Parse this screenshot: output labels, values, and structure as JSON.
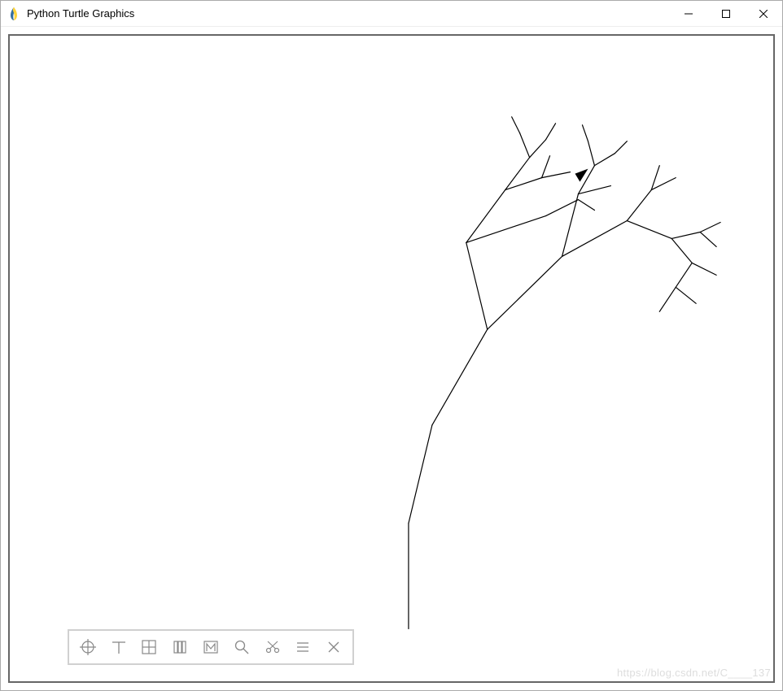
{
  "window": {
    "title": "Python Turtle Graphics",
    "icon_name": "python-feather-icon"
  },
  "controls": {
    "minimize": "Minimize",
    "maximize": "Maximize",
    "close": "Close"
  },
  "toolbar": {
    "items": [
      {
        "name": "target-icon",
        "label": "Target"
      },
      {
        "name": "tee-icon",
        "label": "Tee"
      },
      {
        "name": "grid-icon",
        "label": "Grid"
      },
      {
        "name": "columns-icon",
        "label": "Columns"
      },
      {
        "name": "m-box-icon",
        "label": "M"
      },
      {
        "name": "magnify-icon",
        "label": "Magnify"
      },
      {
        "name": "scissors-icon",
        "label": "Cut"
      },
      {
        "name": "lines-icon",
        "label": "Lines"
      },
      {
        "name": "close-x-icon",
        "label": "Close"
      }
    ]
  },
  "watermark": "https://blog.csdn.net/C____137",
  "drawing": {
    "description": "Recursive fractal tree drawn by turtle, leaning right, with an arrowhead cursor near the top branches.",
    "trunk_start": "bottom center going up, then arcing right into branching structure"
  }
}
